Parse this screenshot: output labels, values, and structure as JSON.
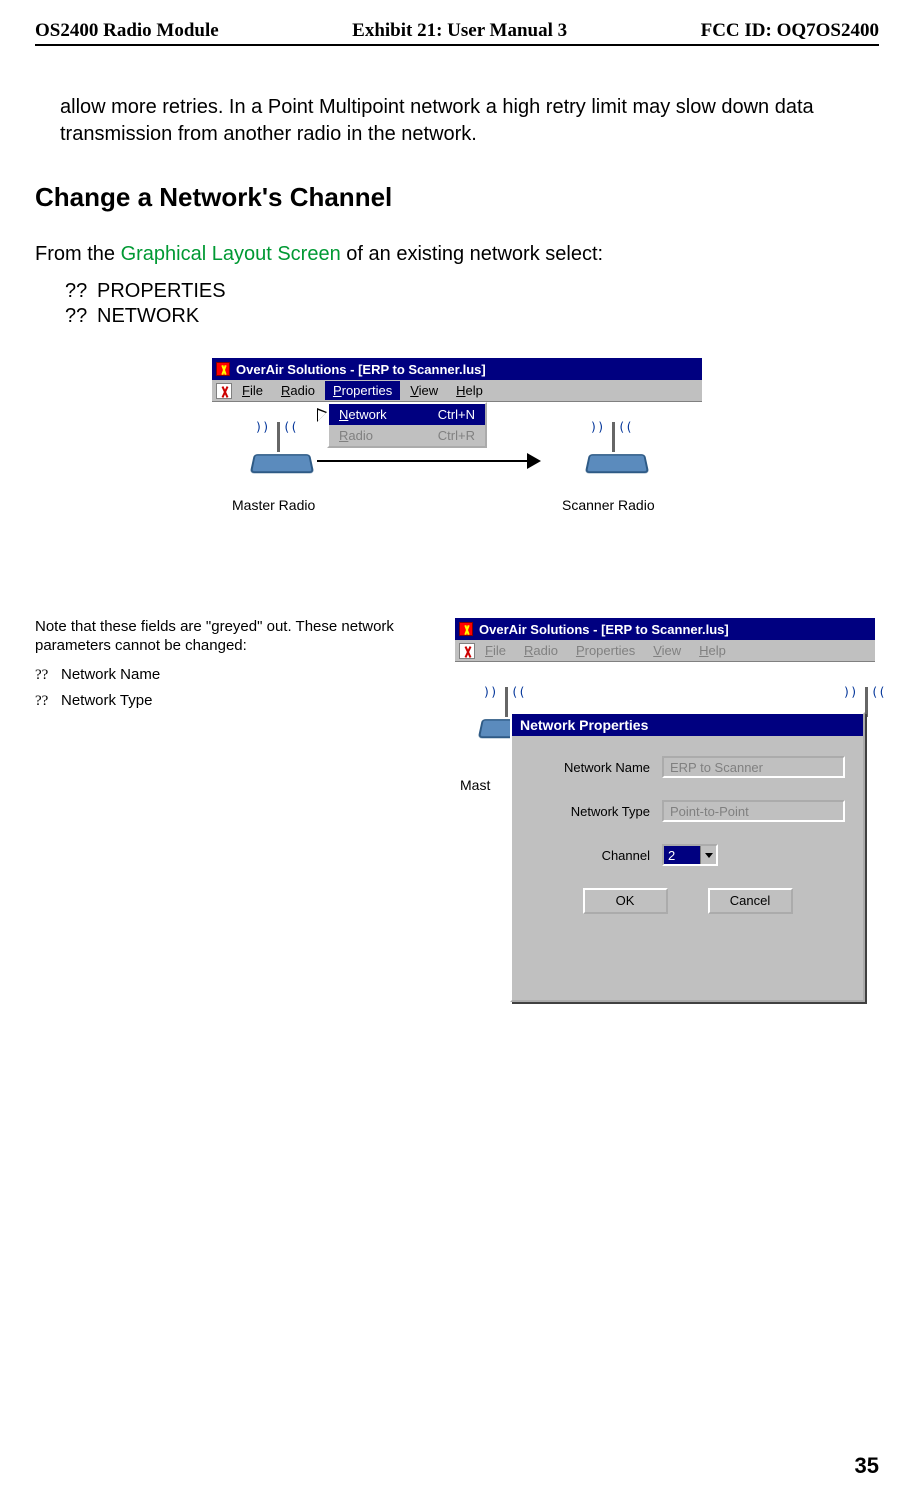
{
  "header": {
    "left": "OS2400 Radio Module",
    "center": "Exhibit 21: User Manual 3",
    "right": "FCC ID: OQ7OS2400"
  },
  "intro_para": "allow more retries.  In a Point Multipoint network a high retry limit may slow down data transmission from another radio in the network.",
  "h2": "Change a Network's Channel",
  "from_line_pre": "From the ",
  "from_line_link": "Graphical Layout Screen",
  "from_line_post": " of an existing network select:",
  "steps": [
    {
      "bullet": "??",
      "text": "PROPERTIES"
    },
    {
      "bullet": "??",
      "text": "NETWORK"
    }
  ],
  "shot1": {
    "title": "OverAir Solutions - [ERP to Scanner.lus]",
    "menu": {
      "file": "File",
      "radio": "Radio",
      "properties": "Properties",
      "view": "View",
      "help": "Help"
    },
    "dropdown": {
      "network": "Network",
      "network_sc": "Ctrl+N",
      "radio": "Radio",
      "radio_sc": "Ctrl+R"
    },
    "master_label": "Master Radio",
    "scanner_label": "Scanner Radio"
  },
  "note": {
    "text": "Note that these fields are \"greyed\" out.  These network parameters cannot be changed:",
    "items": [
      {
        "bullet": "??",
        "text": "Network Name"
      },
      {
        "bullet": "??",
        "text": "Network Type"
      }
    ]
  },
  "shot2": {
    "title": "OverAir Solutions - [ERP to Scanner.lus]",
    "menu": {
      "file": "File",
      "radio": "Radio",
      "properties": "Properties",
      "view": "View",
      "help": "Help"
    },
    "mast": "Mast",
    "dialog": {
      "title": "Network Properties",
      "name_lbl": "Network Name",
      "name_val": "ERP to Scanner",
      "type_lbl": "Network Type",
      "type_val": "Point-to-Point",
      "chan_lbl": "Channel",
      "chan_val": "2",
      "ok": "OK",
      "cancel": "Cancel"
    }
  },
  "page_num": "35"
}
